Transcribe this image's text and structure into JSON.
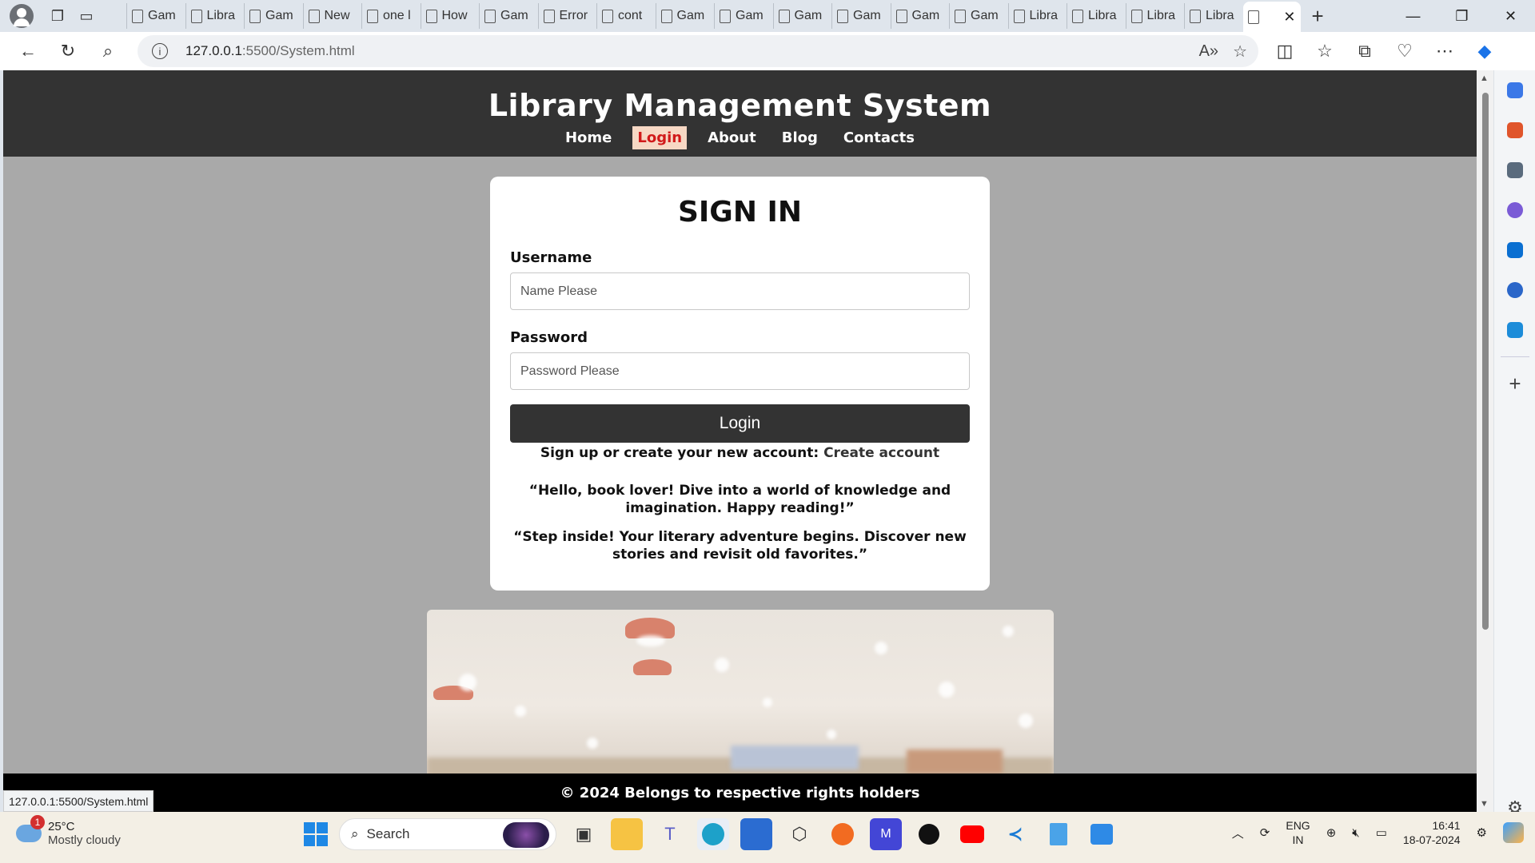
{
  "browser": {
    "tabs": [
      {
        "label": "Gam",
        "icon": "page-icon"
      },
      {
        "label": "Libra",
        "icon": "openai-icon"
      },
      {
        "label": "Gam",
        "icon": "page-icon"
      },
      {
        "label": "New",
        "icon": "newtab-icon"
      },
      {
        "label": "one l",
        "icon": "search-icon"
      },
      {
        "label": "How",
        "icon": "cloud-icon"
      },
      {
        "label": "Gam",
        "icon": "page-icon"
      },
      {
        "label": "Error",
        "icon": "page-icon"
      },
      {
        "label": "cont",
        "icon": "search-icon"
      },
      {
        "label": "Gam",
        "icon": "page-icon"
      },
      {
        "label": "Gam",
        "icon": "page-icon"
      },
      {
        "label": "Gam",
        "icon": "page-icon"
      },
      {
        "label": "Gam",
        "icon": "page-icon"
      },
      {
        "label": "Gam",
        "icon": "page-icon"
      },
      {
        "label": "Gam",
        "icon": "page-icon"
      },
      {
        "label": "Libra",
        "icon": "page-icon"
      },
      {
        "label": "Libra",
        "icon": "page-icon"
      },
      {
        "label": "Libra",
        "icon": "page-icon"
      },
      {
        "label": "Libra",
        "icon": "page-icon"
      }
    ],
    "url_host": "127.0.0.1",
    "url_rest": ":5500/System.html",
    "status_url": "127.0.0.1:5500/System.html"
  },
  "site": {
    "title": "Library Management System",
    "nav": [
      "Home",
      "Login",
      "About",
      "Blog",
      "Contacts"
    ],
    "active_nav": "Login",
    "footer": "© 2024 Belongs to respective rights holders"
  },
  "signin": {
    "heading": "SIGN IN",
    "username_label": "Username",
    "username_placeholder": "Name Please",
    "password_label": "Password",
    "password_placeholder": "Password Please",
    "login_button": "Login",
    "signup_text": "Sign up or create your new account:",
    "signup_link": "Create account",
    "quote1": "“Hello, book lover! Dive into a world of knowledge and imagination. Happy reading!”",
    "quote2": "“Step inside! Your literary adventure begins. Discover new stories and revisit old favorites.”"
  },
  "taskbar": {
    "weather_temp": "25°C",
    "weather_desc": "Mostly cloudy",
    "weather_badge": "1",
    "search_label": "Search",
    "lang_1": "ENG",
    "lang_2": "IN",
    "time": "16:41",
    "date": "18-07-2024"
  },
  "colors": {
    "header_bg": "#333333",
    "nav_active_bg": "#f7d8c4",
    "nav_active_text": "#d11a1a",
    "page_bg": "#a9a9a9",
    "footer_bg": "#000000"
  }
}
